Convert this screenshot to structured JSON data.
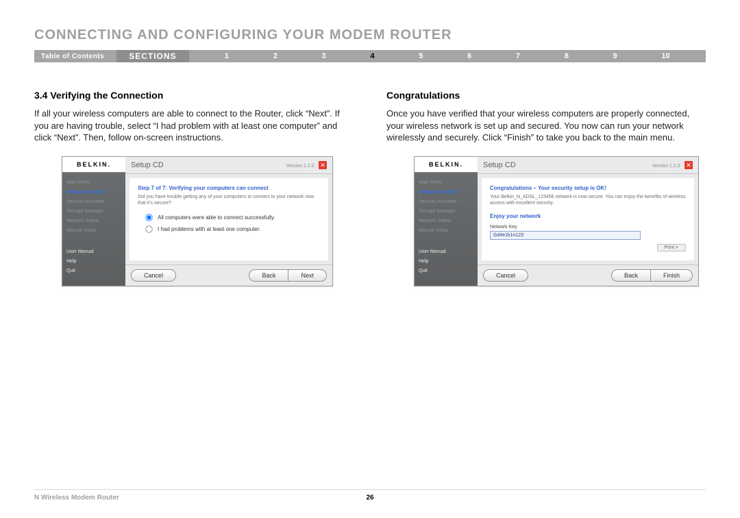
{
  "page_title": "CONNECTING AND CONFIGURING YOUR MODEM ROUTER",
  "nav": {
    "toc": "Table of Contents",
    "sections_label": "SECTIONS",
    "items": [
      {
        "n": "1",
        "active": false
      },
      {
        "n": "2",
        "active": false
      },
      {
        "n": "3",
        "active": false
      },
      {
        "n": "4",
        "active": true
      },
      {
        "n": "5",
        "active": false
      },
      {
        "n": "6",
        "active": false
      },
      {
        "n": "7",
        "active": false
      },
      {
        "n": "8",
        "active": false
      },
      {
        "n": "9",
        "active": false
      },
      {
        "n": "10",
        "active": false
      }
    ]
  },
  "left": {
    "heading": "3.4 Verifying the Connection",
    "body": "If all your wireless computers are able to connect to the Router, click “Next”. If you are having trouble, select “I had problem with at least one computer” and click “Next”. Then, follow on-screen instructions."
  },
  "right": {
    "heading": "Congratulations",
    "body": "Once you have verified that your wireless computers are properly connected, your wireless network is set up and secured. You now can run your network wirelessly and securely. Click “Finish” to take you back to the main menu."
  },
  "app_common": {
    "brand": "BELKIN.",
    "title": "Setup CD",
    "version": "Version 1.1.0",
    "sidebar": {
      "main_menu": "Main Menu",
      "setup_assistant": "Setup Assistant  >",
      "security_assistant": "Security Assistant",
      "storage_manager": "Storage Manager",
      "network_status": "Network Status",
      "manual_setup": "Manual Setup",
      "user_manual": "User Manual",
      "help": "Help",
      "quit": "Quit"
    },
    "buttons": {
      "cancel": "Cancel",
      "back": "Back",
      "next": "Next",
      "finish": "Finish",
      "print": "Print >"
    }
  },
  "app1": {
    "step_hd": "Step 7 of 7:  Verifying your computers can connect",
    "step_sub": "Did you have trouble getting any of your computers to connect to your network now that it’s secure?",
    "opt1": "All computers were able to connect successfully.",
    "opt2": "I had problems with at least one computer."
  },
  "app2": {
    "congrats_hd": "Congratulations – Your security setup is OK!",
    "congrats_sub": "Your Belkin_N_ADSL_123456 network is now secure. You can enjoy the benefits of wireless access with excellent security.",
    "enjoy": "Enjoy your network",
    "nk_label": "Network Key",
    "nk_value": "Gd4e1k1n123"
  },
  "footer": {
    "product": "N Wireless Modem Router",
    "page": "26"
  }
}
